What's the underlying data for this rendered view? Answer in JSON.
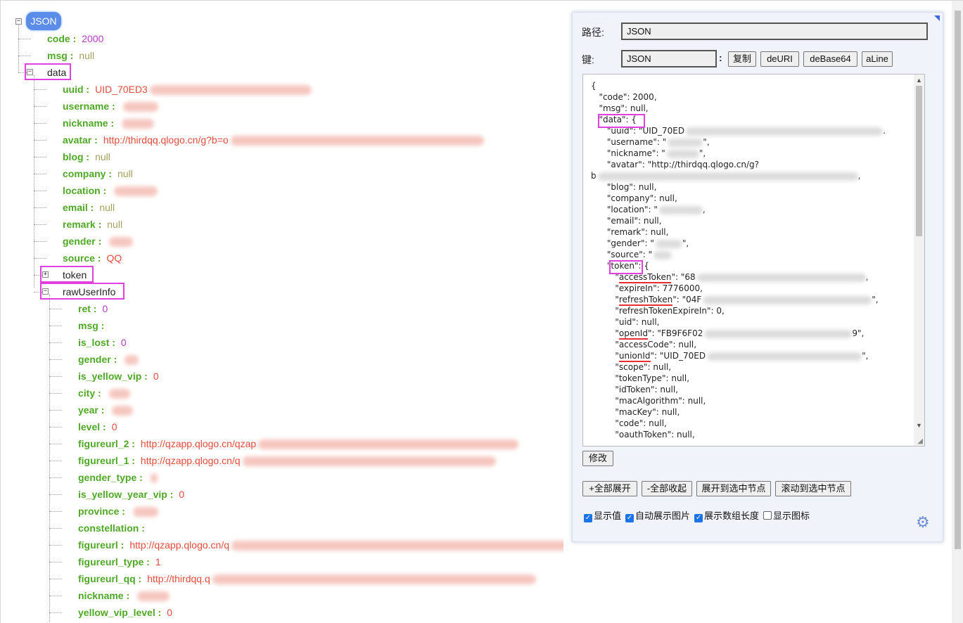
{
  "tree": {
    "root_label": "JSON",
    "rows": [
      {
        "key": "code :",
        "value": "2000",
        "vtype": "num"
      },
      {
        "key": "msg :",
        "value": "null",
        "vtype": "null"
      },
      {
        "key": "data",
        "value": "",
        "vtype": "node"
      },
      {
        "key": "uuid :",
        "value": "UID_70ED3",
        "vtype": "str"
      },
      {
        "key": "username :",
        "value": "",
        "vtype": "str"
      },
      {
        "key": "nickname :",
        "value": "",
        "vtype": "str"
      },
      {
        "key": "avatar :",
        "value": "http://thirdqq.qlogo.cn/g?b=o",
        "vtype": "str"
      },
      {
        "key": "blog :",
        "value": "null",
        "vtype": "null"
      },
      {
        "key": "company :",
        "value": "null",
        "vtype": "null"
      },
      {
        "key": "location :",
        "value": "",
        "vtype": "str"
      },
      {
        "key": "email :",
        "value": "null",
        "vtype": "null"
      },
      {
        "key": "remark :",
        "value": "null",
        "vtype": "null"
      },
      {
        "key": "gender :",
        "value": "",
        "vtype": "str"
      },
      {
        "key": "source :",
        "value": "QQ",
        "vtype": "str"
      },
      {
        "key": "token",
        "value": "",
        "vtype": "node"
      },
      {
        "key": "rawUserInfo",
        "value": "",
        "vtype": "node"
      },
      {
        "key": "ret :",
        "value": "0",
        "vtype": "num"
      },
      {
        "key": "msg :",
        "value": "",
        "vtype": "str"
      },
      {
        "key": "is_lost :",
        "value": "0",
        "vtype": "num"
      },
      {
        "key": "gender :",
        "value": "",
        "vtype": "str"
      },
      {
        "key": "is_yellow_vip :",
        "value": "0",
        "vtype": "str"
      },
      {
        "key": "city :",
        "value": "",
        "vtype": "str"
      },
      {
        "key": "year :",
        "value": "",
        "vtype": "str"
      },
      {
        "key": "level :",
        "value": "0",
        "vtype": "str"
      },
      {
        "key": "figureurl_2 :",
        "value": "http://qzapp.qlogo.cn/qzap",
        "vtype": "str"
      },
      {
        "key": "figureurl_1 :",
        "value": "http://qzapp.qlogo.cn/q",
        "vtype": "str"
      },
      {
        "key": "gender_type :",
        "value": "",
        "vtype": "str"
      },
      {
        "key": "is_yellow_year_vip :",
        "value": "0",
        "vtype": "str"
      },
      {
        "key": "province :",
        "value": "",
        "vtype": "str"
      },
      {
        "key": "constellation :",
        "value": "",
        "vtype": "str"
      },
      {
        "key": "figureurl :",
        "value": "http://qzapp.qlogo.cn/q",
        "vtype": "str"
      },
      {
        "key": "figureurl_type :",
        "value": "1",
        "vtype": "str"
      },
      {
        "key": "figureurl_qq :",
        "value": "http://thirdqq.q",
        "vtype": "str"
      },
      {
        "key": "nickname :",
        "value": "",
        "vtype": "str"
      },
      {
        "key": "yellow_vip_level :",
        "value": "0",
        "vtype": "str"
      }
    ]
  },
  "panel": {
    "path_label": "路径:",
    "path_value": "JSON",
    "key_label": "键:",
    "key_value": "JSON",
    "key_colon": ":",
    "btn_copy": "复制",
    "btn_deuri": "deURI",
    "btn_debase64": "deBase64",
    "btn_aline": "aLine",
    "btn_modify": "修改",
    "btn_expand_all": "+全部展开",
    "btn_collapse_all": "-全部收起",
    "btn_expand_to_selected": "展开到选中节点",
    "btn_scroll_to_selected": "滚动到选中节点",
    "checkboxes": [
      {
        "label": "显示值",
        "checked": true
      },
      {
        "label": "自动展示图片",
        "checked": true
      },
      {
        "label": "展示数组长度",
        "checked": true
      },
      {
        "label": "显示图标",
        "checked": false
      }
    ],
    "code_lines": [
      "{",
      "   \"code\": 2000,",
      "   \"msg\": null,",
      "   \"data\": {",
      "      \"uuid\": \"UID_70ED",
      "      \"username\": \"",
      "      \"nickname\": \"",
      "      \"avatar\": \"http://thirdqq.qlogo.cn/g?",
      "b",
      "      \"blog\": null,",
      "      \"company\": null,",
      "      \"location\": \"",
      "      \"email\": null,",
      "      \"remark\": null,",
      "      \"gender\": \"",
      "      \"source\": \"",
      "      \"token\": {",
      "         \"accessToken\": \"68",
      "         \"expireIn\": 7776000,",
      "         \"refreshToken\": \"04F",
      "         \"refreshTokenExpireIn\": 0,",
      "         \"uid\": null,",
      "         \"openId\": \"FB9F6F02",
      "         \"accessCode\": null,",
      "         \"unionId\": \"UID_70ED",
      "         \"scope\": null,",
      "         \"tokenType\": null,",
      "         \"idToken\": null,",
      "         \"macAlgorithm\": null,",
      "         \"macKey\": null,",
      "         \"code\": null,",
      "         \"oauthToken\": null,"
    ],
    "code_tails": [
      "",
      "",
      "",
      "",
      ".",
      "\",",
      "\",",
      "",
      ",",
      "",
      "",
      ",",
      "",
      "",
      "\",",
      "",
      "",
      ",",
      "",
      "\",",
      "",
      "",
      "9\",",
      "",
      "\",",
      "",
      "",
      "",
      "",
      "",
      "",
      ""
    ],
    "underline_keys": [
      "accessToken",
      "refreshToken",
      "openId",
      "unionId"
    ]
  },
  "colors": {
    "key": "#4fa825",
    "string": "#e84a3c",
    "number": "#b23cc2",
    "null": "#a6a060",
    "highlight": "#e040e0",
    "badge": "#5a8ce8"
  }
}
